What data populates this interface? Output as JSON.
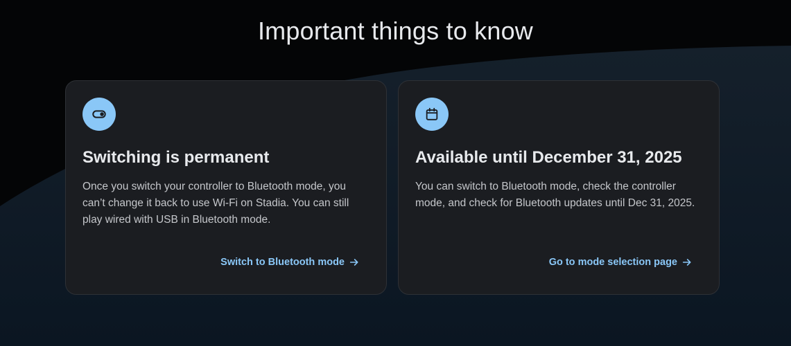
{
  "page": {
    "title": "Important things to know"
  },
  "cards": [
    {
      "icon": "toggle-icon",
      "title": "Switching is permanent",
      "body": "Once you switch your controller to Bluetooth mode, you can’t change it back to use Wi-Fi on Stadia. You can still play wired with USB in Bluetooth mode.",
      "link": "Switch to Bluetooth mode"
    },
    {
      "icon": "calendar-icon",
      "title": "Available until December 31, 2025",
      "body": "You can switch to Bluetooth mode, check the controller mode, and check for Bluetooth updates until Dec 31, 2025.",
      "link": "Go to mode selection page"
    }
  ],
  "colors": {
    "accent": "#8ac7f7",
    "card_bg": "#1b1d21",
    "page_bg": "#040506"
  }
}
